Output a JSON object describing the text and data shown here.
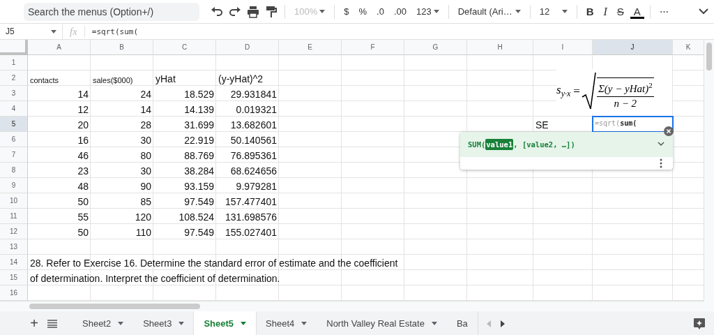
{
  "toolbar": {
    "search": {
      "placeholder": "Search the menus (Option+/)"
    },
    "zoom": {
      "value": "100%",
      "disabled": true
    },
    "format_buttons": [
      "$",
      "%",
      ".0",
      ".00",
      "123"
    ],
    "font": "Default (Ari…",
    "font_size": "12",
    "style_buttons": [
      {
        "kind": "bold",
        "label": "B"
      },
      {
        "kind": "italic",
        "label": "I"
      },
      {
        "kind": "strike",
        "label": "S"
      },
      {
        "kind": "color",
        "label": "A"
      }
    ],
    "more": "⋯"
  },
  "formula_bar": {
    "cell": "J5",
    "fx": "fx",
    "formula": "=sqrt(sum("
  },
  "columns": [
    {
      "label": "A",
      "selected": false
    },
    {
      "label": "B",
      "selected": false
    },
    {
      "label": "C",
      "selected": false
    },
    {
      "label": "D",
      "selected": false
    },
    {
      "label": "E",
      "selected": false
    },
    {
      "label": "F",
      "selected": false
    },
    {
      "label": "G",
      "selected": false
    },
    {
      "label": "H",
      "selected": false
    },
    {
      "label": "I",
      "selected": false
    },
    {
      "label": "J",
      "selected": true
    },
    {
      "label": "K",
      "selected": false
    }
  ],
  "rows": [
    {
      "number": "1",
      "selected": false
    },
    {
      "number": "2",
      "selected": false
    },
    {
      "number": "3",
      "selected": false
    },
    {
      "number": "4",
      "selected": false
    },
    {
      "number": "5",
      "selected": true
    },
    {
      "number": "6",
      "selected": false
    },
    {
      "number": "7",
      "selected": false
    },
    {
      "number": "8",
      "selected": false
    },
    {
      "number": "9",
      "selected": false
    },
    {
      "number": "10",
      "selected": false
    },
    {
      "number": "11",
      "selected": false
    },
    {
      "number": "12",
      "selected": false
    },
    {
      "number": "13",
      "selected": false
    },
    {
      "number": "14",
      "selected": false
    },
    {
      "number": "15",
      "selected": false
    },
    {
      "number": "16",
      "selected": false
    }
  ],
  "data_table": {
    "headers": [
      {
        "kind": "small",
        "text": "contacts"
      },
      {
        "kind": "small",
        "text": "sales($000)"
      },
      {
        "kind": "large",
        "text": "yHat"
      },
      {
        "kind": "large",
        "text": "(y-yHat)^2"
      }
    ],
    "rows": [
      [
        "14",
        "24",
        "18.529",
        "29.931841"
      ],
      [
        "12",
        "14",
        "14.139",
        "0.019321"
      ],
      [
        "20",
        "28",
        "31.699",
        "13.682601"
      ],
      [
        "16",
        "30",
        "22.919",
        "50.140561"
      ],
      [
        "46",
        "80",
        "88.769",
        "76.895361"
      ],
      [
        "23",
        "30",
        "38.284",
        "68.624656"
      ],
      [
        "48",
        "90",
        "93.159",
        "9.979281"
      ],
      [
        "50",
        "85",
        "97.549",
        "157.477401"
      ],
      [
        "55",
        "120",
        "108.524",
        "131.698576"
      ],
      [
        "50",
        "110",
        "97.549",
        "155.027401"
      ]
    ]
  },
  "notes": [
    "28. Refer to Exercise 16. Determine the standard error of estimate and the coefficient",
    "of determination. Interpret the coefficient of determination."
  ],
  "side_entry": {
    "label": "SE",
    "editor_value": "=sqrt(**sum(**"
  },
  "formula_image": {
    "lhs": "s",
    "lhs_sub": "y·x",
    "equals": "=",
    "numerator": "Σ(y − yHat)",
    "numerator_sup": "2",
    "denominator": "n − 2"
  },
  "autocomplete": {
    "parts": [
      {
        "kind": "plain",
        "text": "SUM("
      },
      {
        "kind": "current",
        "text": "value1"
      },
      {
        "kind": "plain",
        "text": ", [value2, …])"
      }
    ]
  },
  "sheet_tabs": [
    {
      "label": "Sheet2",
      "selected": false,
      "caret": true
    },
    {
      "label": "Sheet3",
      "selected": false,
      "caret": true
    },
    {
      "label": "Sheet5",
      "selected": true,
      "caret": true
    },
    {
      "label": "Sheet4",
      "selected": false,
      "caret": true
    },
    {
      "label": "North Valley Real Estate",
      "selected": false,
      "caret": true
    },
    {
      "label": "Ba",
      "selected": false,
      "caret": false
    }
  ],
  "tab_bar": {
    "add": "+"
  }
}
